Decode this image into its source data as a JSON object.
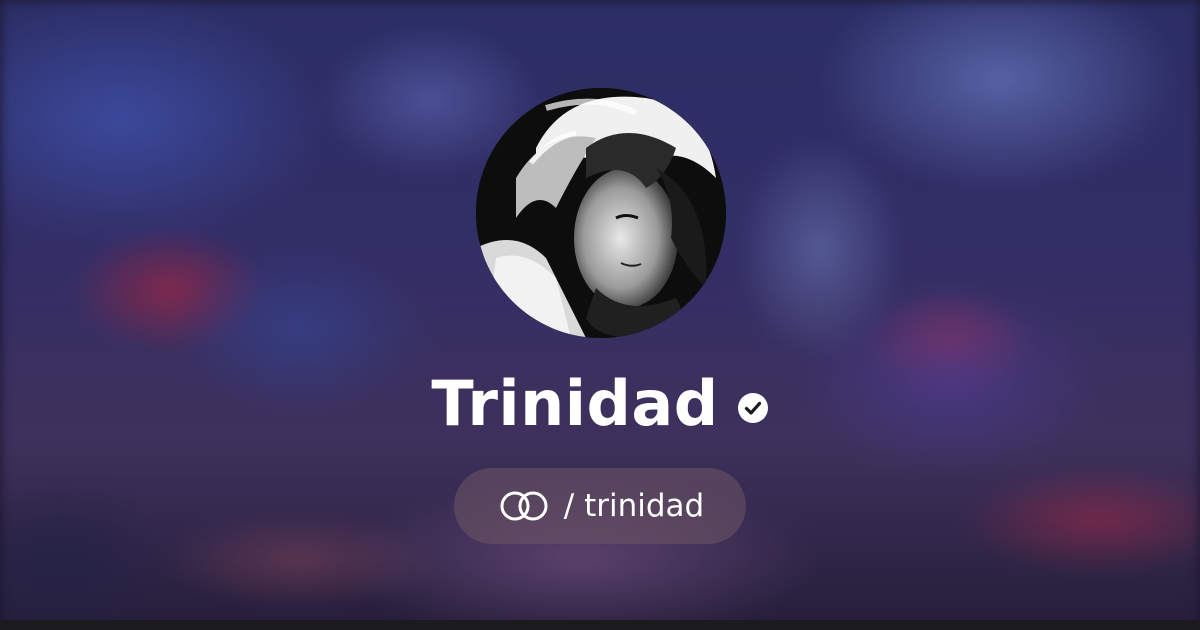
{
  "profile": {
    "name": "Trinidad",
    "verified": true,
    "handle": "/ trinidad",
    "avatar_description": "black and white anime-style portrait"
  },
  "icons": {
    "verified": "verified-check-icon",
    "platform": "linked-rings-icon"
  },
  "colors": {
    "text": "#ffffff",
    "pill_background": "rgba(110,85,100,0.55)",
    "bottom_bar": "#1b1b1d"
  }
}
